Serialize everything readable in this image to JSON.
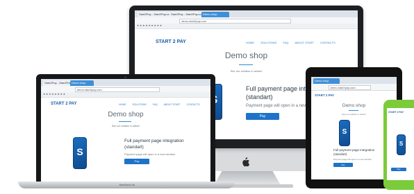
{
  "site": {
    "brand": "START 2 PAY",
    "shop_title": "Demo shop",
    "subtitle": "See our solution in action!",
    "headline_line1": "Full payment page integration",
    "headline_line2": "(standart)",
    "note": "Payment page will open in a new window",
    "pay_label": "Pay",
    "nav": [
      "HOME",
      "SOLUTIONS",
      "FAQ",
      "ABOUT START",
      "CONTACTS"
    ],
    "phone_logo": "S"
  },
  "browser": {
    "tab1": "Start2Pay - Start2Pay.com",
    "tab2": "Demo shop",
    "url": "demo.start2pay.com"
  },
  "laptop": {
    "label": "MacBook Air"
  },
  "icons": {
    "monitor_logo": "apple-icon"
  },
  "colors": {
    "brand_blue": "#1b5fa8",
    "accent_blue": "#2c8bd8",
    "button_blue": "#1e73c8",
    "phone_case": "#7ccb3a"
  }
}
